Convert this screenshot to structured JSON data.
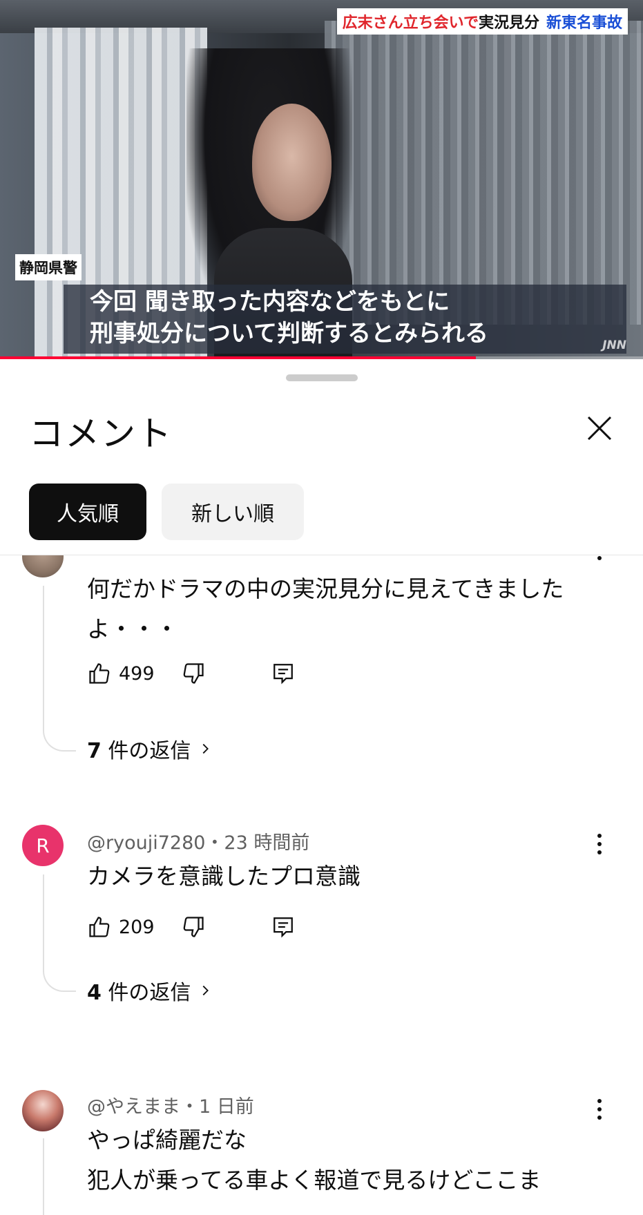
{
  "video": {
    "headline_red": "広末さん立ち会いで",
    "headline_black": "実況見分",
    "headline_blue": "新東名事故",
    "source_label": "静岡県警",
    "caption_line1": "今回 聞き取った内容などをもとに",
    "caption_line2": "刑事処分について判断するとみられる",
    "watermark": "JNN",
    "progress_fraction": 0.74,
    "progress_color": "#ff0033"
  },
  "sheet": {
    "title": "コメント",
    "close_icon": "close-icon"
  },
  "sort_chips": {
    "active": "人気順",
    "inactive": "新しい順"
  },
  "comments": [
    {
      "avatar_type": "photo",
      "meta": "",
      "body": "何だかドラマの中の実況見分に見えてきましたよ・・・",
      "likes": "499",
      "replies_count": "7",
      "replies_text": "件の返信"
    },
    {
      "avatar_type": "letter",
      "avatar_letter": "R",
      "avatar_color": "#e8336b",
      "meta": "@ryouji7280・23 時間前",
      "body": "カメラを意識したプロ意識",
      "likes": "209",
      "replies_count": "4",
      "replies_text": "件の返信"
    },
    {
      "avatar_type": "anime",
      "meta": "@やえまま・1 日前",
      "body": "やっぱ綺麗だな",
      "body_line2": "犯人が乗ってる車よく報道で見るけどここま"
    }
  ]
}
